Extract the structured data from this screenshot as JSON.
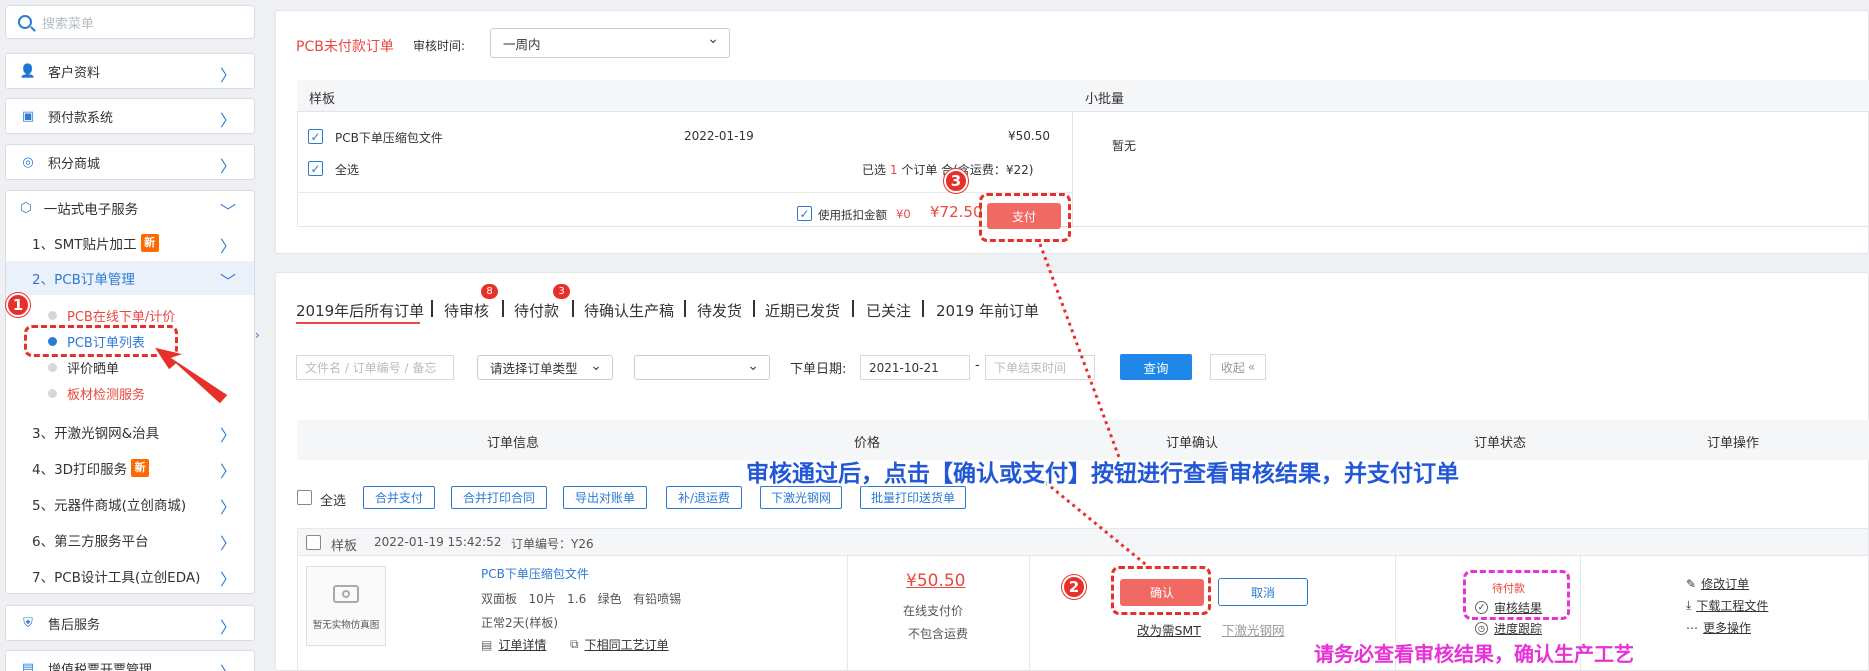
{
  "sidebar": {
    "search_placeholder": "搜索菜单",
    "customer": "客户资料",
    "prepay": "预付款系统",
    "points": "积分商城",
    "one_stop": "一站式电子服务",
    "smt": "1、SMT贴片加工",
    "pcb_mgmt": "2、PCB订单管理",
    "pcb_online": "PCB在线下单/计价",
    "pcb_list": "PCB订单列表",
    "review": "评价晒单",
    "board_test": "板材检测服务",
    "stencil": "3、开激光钢网&治具",
    "print3d": "4、3D打印服务",
    "components": "5、元器件商城(立创商城)",
    "third_party": "6、第三方服务平台",
    "eda": "7、PCB设计工具(立创EDA)",
    "after_sales": "售后服务",
    "invoice": "增值税票开票管理",
    "new_badge": "新"
  },
  "unpaid": {
    "title": "PCB未付款订单",
    "review_time_label": "审核时间:",
    "review_time_value": "一周内",
    "sample_header": "样板",
    "small_batch_header": "小批量",
    "item_name": "PCB下单压缩包文件",
    "item_date": "2022-01-19",
    "item_price": "¥50.50",
    "select_all": "全选",
    "selected_summary_a": "已选",
    "selected_count": "1",
    "selected_summary_b": "个订单 合",
    "shipping_note": "(含运费：¥22)",
    "small_batch_empty": "暂无",
    "use_deduct": "使用抵扣金额",
    "deduct_amount": "¥0",
    "total": "¥72.50",
    "pay_button": "支付"
  },
  "orders": {
    "tabs": [
      "2019年后所有订单",
      "待审核",
      "待付款",
      "待确认生产稿",
      "待发货",
      "近期已发货",
      "已关注",
      "2019 年前订单"
    ],
    "badge_review": "8",
    "badge_pay": "3",
    "filter_keyword_placeholder": "文件名 / 订单编号 / 备忘",
    "filter_type": "请选择订单类型",
    "order_date_label": "下单日期:",
    "date_from": "2021-10-21",
    "date_to_placeholder": "下单结束时间",
    "query_button": "查询",
    "collapse_label": "收起",
    "columns": [
      "订单信息",
      "价格",
      "订单确认",
      "订单状态",
      "订单操作"
    ],
    "select_all": "全选",
    "actions": [
      "合并支付",
      "合并打印合同",
      "导出对账单",
      "补/退运费",
      "下激光钢网",
      "批量打印送货单"
    ],
    "row": {
      "type": "样板",
      "datetime": "2022-01-19 15:42:52",
      "order_no": "订单编号：Y26",
      "thumb_label": "暂无实物仿真图",
      "file_name": "PCB下单压缩包文件",
      "spec": "双面板   10片   1.6   绿色   有铅喷锡",
      "lead_time": "正常2天(样板)",
      "detail_link": "订单详情",
      "reorder_link": "下相同工艺订单",
      "price": "¥50.50",
      "pay_method": "在线支付价",
      "shipping": "不包含运费",
      "confirm_button": "确认",
      "cancel_button": "取消",
      "to_smt": "改为需SMT",
      "laser_stencil": "下激光钢网",
      "status": "待付款",
      "audit_result": "审核结果",
      "progress": "进度跟踪",
      "op_edit": "修改订单",
      "op_download": "下载工程文件",
      "op_more": "更多操作"
    }
  },
  "annotations": {
    "m1": "1",
    "m2": "2",
    "m3": "3",
    "callout_main": "审核通过后，点击【确认或支付】按钮进行查看审核结果，并支付订单",
    "callout_note": "请务必查看审核结果，确认生产工艺"
  },
  "colors": {
    "accent_blue": "#2d7ad3",
    "accent_red": "#e8483f",
    "callout_blue": "#2258d6",
    "callout_pink": "#e632d6"
  }
}
